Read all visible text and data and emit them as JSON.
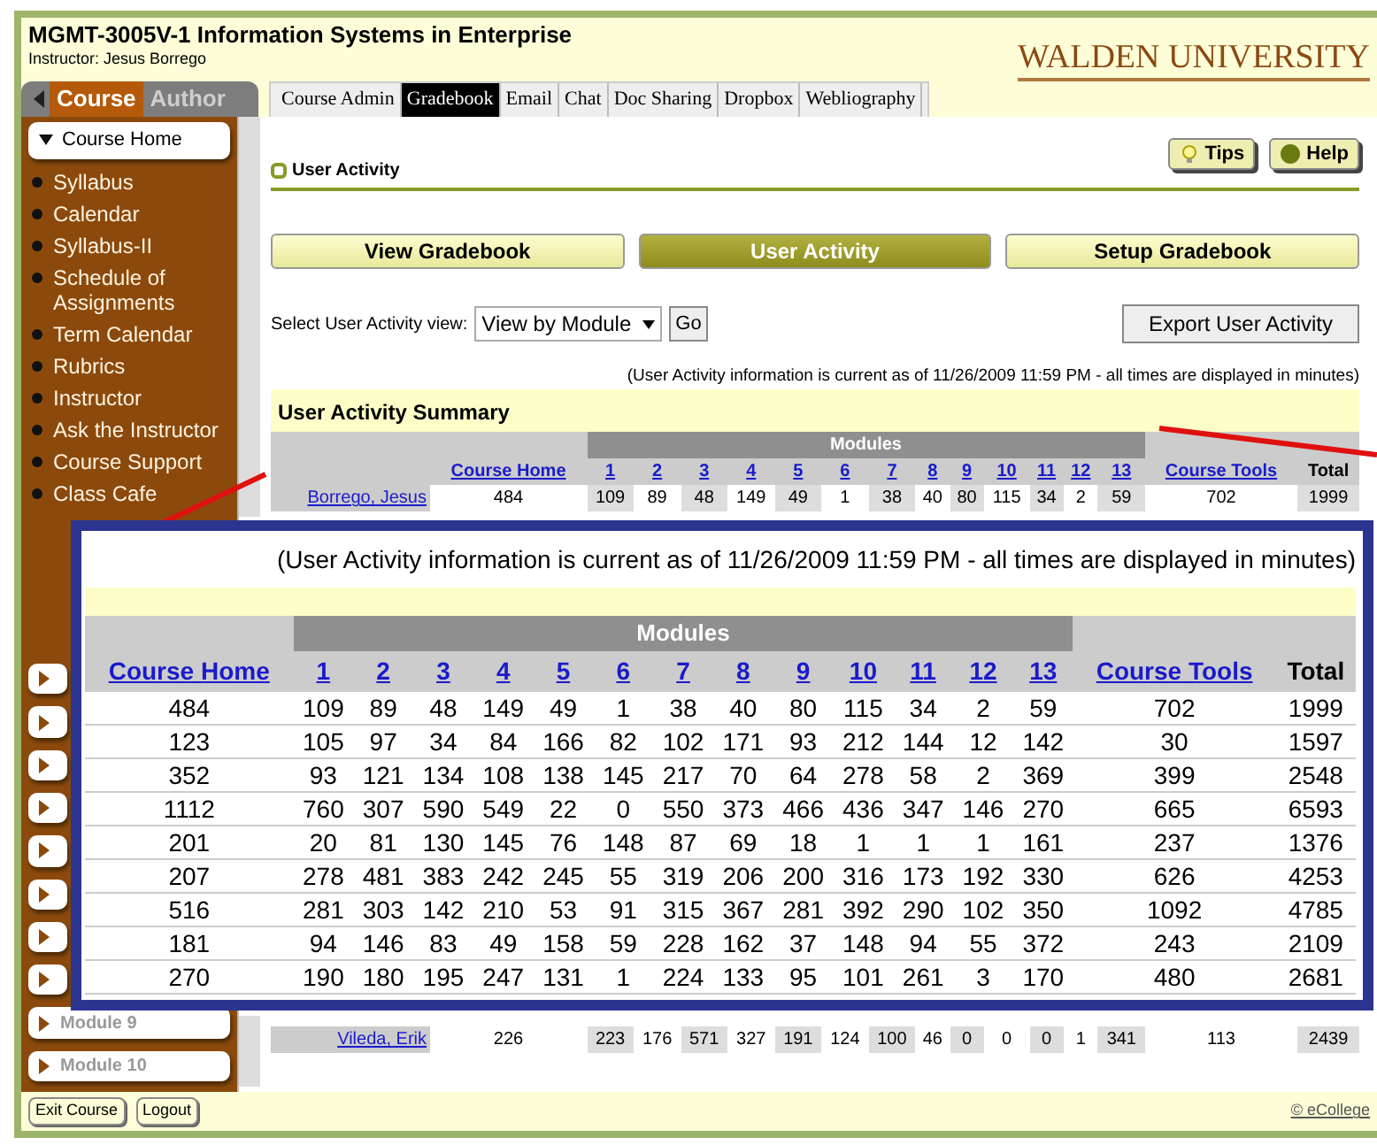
{
  "course_title": "MGMT-3005V-1 Information Systems in Enterprise",
  "instructor": "Instructor: Jesus Borrego",
  "logo": "WALDEN UNIVERSITY",
  "side_tabs": [
    {
      "label": "Course",
      "selected": true
    },
    {
      "label": "Author",
      "selected": false
    }
  ],
  "top_tabs": [
    {
      "label": "Course Admin",
      "selected": false
    },
    {
      "label": "Gradebook",
      "selected": true
    },
    {
      "label": "Email",
      "selected": false
    },
    {
      "label": "Chat",
      "selected": false
    },
    {
      "label": "Doc Sharing",
      "selected": false
    },
    {
      "label": "Dropbox",
      "selected": false
    },
    {
      "label": "Webliography",
      "selected": false
    }
  ],
  "sidebar": {
    "header": "Course Home",
    "links": [
      "Syllabus",
      "Calendar",
      "Syllabus-II",
      "Schedule of Assignments",
      "Term Calendar",
      "Rubrics",
      "Instructor",
      "Ask the Instructor",
      "Course Support",
      "Class Cafe"
    ],
    "module_buttons": [
      {
        "kind": "covered"
      },
      {
        "kind": "covered"
      },
      {
        "kind": "covered"
      },
      {
        "kind": "covered"
      },
      {
        "kind": "covered"
      },
      {
        "kind": "covered"
      },
      {
        "kind": "covered"
      },
      {
        "kind": "covered"
      },
      {
        "kind": "labeled",
        "label": "Module 9"
      },
      {
        "kind": "labeled",
        "label": "Module 10"
      }
    ]
  },
  "section_title": "User Activity",
  "tips": "Tips",
  "help": "Help",
  "views": [
    {
      "label": "View Gradebook",
      "selected": false
    },
    {
      "label": "User Activity",
      "selected": true
    },
    {
      "label": "Setup Gradebook",
      "selected": false
    }
  ],
  "select": {
    "label": "Select User Activity view:",
    "value": "View by Module",
    "go": "Go"
  },
  "export": "Export User Activity",
  "note": "(User Activity information is current as of 11/26/2009 11:59 PM - all times are displayed in minutes)",
  "summary_title": "User Activity Summary",
  "table": {
    "group_header": "Modules",
    "columns": [
      {
        "label": "Course Home",
        "kind": "link"
      },
      {
        "label": "1",
        "kind": "link"
      },
      {
        "label": "2",
        "kind": "link"
      },
      {
        "label": "3",
        "kind": "link"
      },
      {
        "label": "4",
        "kind": "link"
      },
      {
        "label": "5",
        "kind": "link"
      },
      {
        "label": "6",
        "kind": "link"
      },
      {
        "label": "7",
        "kind": "link"
      },
      {
        "label": "8",
        "kind": "link"
      },
      {
        "label": "9",
        "kind": "link"
      },
      {
        "label": "10",
        "kind": "link"
      },
      {
        "label": "11",
        "kind": "link"
      },
      {
        "label": "12",
        "kind": "link"
      },
      {
        "label": "13",
        "kind": "link"
      },
      {
        "label": "Course Tools",
        "kind": "link"
      },
      {
        "label": "Total",
        "kind": "plain"
      }
    ],
    "rows": [
      {
        "name": "Borrego, Jesus",
        "cells": [
          "484",
          "109",
          "89",
          "48",
          "149",
          "49",
          "1",
          "38",
          "40",
          "80",
          "115",
          "34",
          "2",
          "59",
          "702",
          "1999"
        ]
      },
      {
        "name": "Vileda, Erik",
        "cells": [
          "226",
          "223",
          "176",
          "571",
          "327",
          "191",
          "124",
          "100",
          "46",
          "0",
          "0",
          "0",
          "1",
          "341",
          "113",
          "2439"
        ]
      }
    ]
  },
  "zoom": {
    "note": "(User Activity information is current as of 11/26/2009 11:59 PM - all times are displayed in minutes)",
    "group_header": "Modules",
    "columns": [
      {
        "label": "Course Home",
        "kind": "link"
      },
      {
        "label": "1",
        "kind": "link"
      },
      {
        "label": "2",
        "kind": "link"
      },
      {
        "label": "3",
        "kind": "link"
      },
      {
        "label": "4",
        "kind": "link"
      },
      {
        "label": "5",
        "kind": "link"
      },
      {
        "label": "6",
        "kind": "link"
      },
      {
        "label": "7",
        "kind": "link"
      },
      {
        "label": "8",
        "kind": "link"
      },
      {
        "label": "9",
        "kind": "link"
      },
      {
        "label": "10",
        "kind": "link"
      },
      {
        "label": "11",
        "kind": "link"
      },
      {
        "label": "12",
        "kind": "link"
      },
      {
        "label": "13",
        "kind": "link"
      },
      {
        "label": "Course Tools",
        "kind": "link"
      },
      {
        "label": "Total",
        "kind": "plain"
      }
    ],
    "rows": [
      [
        "484",
        "109",
        "89",
        "48",
        "149",
        "49",
        "1",
        "38",
        "40",
        "80",
        "115",
        "34",
        "2",
        "59",
        "702",
        "1999"
      ],
      [
        "123",
        "105",
        "97",
        "34",
        "84",
        "166",
        "82",
        "102",
        "171",
        "93",
        "212",
        "144",
        "12",
        "142",
        "30",
        "1597"
      ],
      [
        "352",
        "93",
        "121",
        "134",
        "108",
        "138",
        "145",
        "217",
        "70",
        "64",
        "278",
        "58",
        "2",
        "369",
        "399",
        "2548"
      ],
      [
        "1112",
        "760",
        "307",
        "590",
        "549",
        "22",
        "0",
        "550",
        "373",
        "466",
        "436",
        "347",
        "146",
        "270",
        "665",
        "6593"
      ],
      [
        "201",
        "20",
        "81",
        "130",
        "145",
        "76",
        "148",
        "87",
        "69",
        "18",
        "1",
        "1",
        "1",
        "161",
        "237",
        "1376"
      ],
      [
        "207",
        "278",
        "481",
        "383",
        "242",
        "245",
        "55",
        "319",
        "206",
        "200",
        "316",
        "173",
        "192",
        "330",
        "626",
        "4253"
      ],
      [
        "516",
        "281",
        "303",
        "142",
        "210",
        "53",
        "91",
        "315",
        "367",
        "281",
        "392",
        "290",
        "102",
        "350",
        "1092",
        "4785"
      ],
      [
        "181",
        "94",
        "146",
        "83",
        "49",
        "158",
        "59",
        "228",
        "162",
        "37",
        "148",
        "94",
        "55",
        "372",
        "243",
        "2109"
      ],
      [
        "270",
        "190",
        "180",
        "195",
        "247",
        "131",
        "1",
        "224",
        "133",
        "95",
        "101",
        "261",
        "3",
        "170",
        "480",
        "2681"
      ]
    ]
  },
  "footer": {
    "buttons": [
      "Exit Course",
      "Logout"
    ],
    "copyright": "© eCollege"
  }
}
